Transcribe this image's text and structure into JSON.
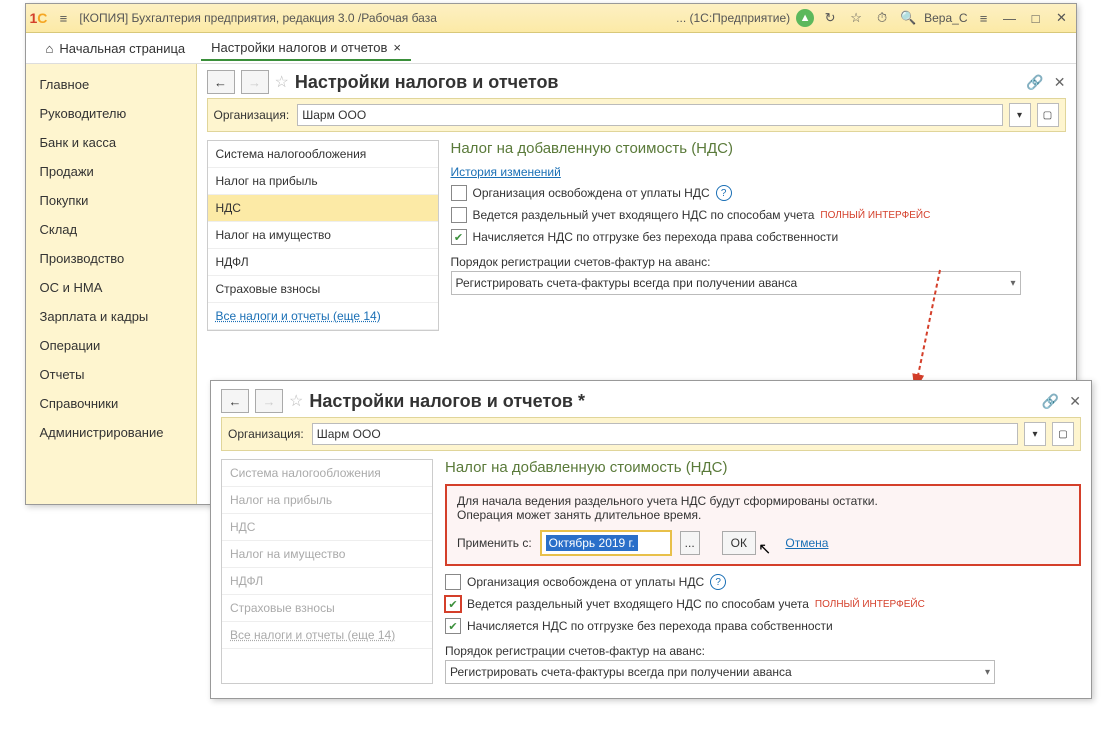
{
  "titlebar": {
    "app_title": "[КОПИЯ] Бухгалтерия предприятия, редакция 3.0 /Рабочая база",
    "suffix": "... (1С:Предприятие)",
    "user": "Вера_С"
  },
  "tabs": {
    "home": "Начальная страница",
    "active": "Настройки налогов и отчетов"
  },
  "sidebar": {
    "items": [
      "Главное",
      "Руководителю",
      "Банк и касса",
      "Продажи",
      "Покупки",
      "Склад",
      "Производство",
      "ОС и НМА",
      "Зарплата и кадры",
      "Операции",
      "Отчеты",
      "Справочники",
      "Администрирование"
    ]
  },
  "page": {
    "title": "Настройки налогов и отчетов",
    "title_modified": "Настройки налогов и отчетов *",
    "org_label": "Организация:",
    "org_value": "Шарм ООО"
  },
  "settings_list": {
    "items": [
      "Система налогообложения",
      "Налог на прибыль",
      "НДС",
      "Налог на имущество",
      "НДФЛ",
      "Страховые взносы"
    ],
    "link": "Все налоги и отчеты (еще 14)"
  },
  "vat": {
    "section_title": "Налог на добавленную стоимость (НДС)",
    "history_link": "История изменений",
    "chk1": "Организация освобождена от уплаты НДС",
    "chk2": "Ведется раздельный учет входящего НДС по способам учета",
    "badge": "ПОЛНЫЙ ИНТЕРФЕЙС",
    "chk3": "Начисляется НДС по отгрузке без перехода права собственности",
    "select_label": "Порядок регистрации счетов-фактур на аванс:",
    "select_value": "Регистрировать счета-фактуры всегда при получении аванса"
  },
  "alert": {
    "line1": "Для начала ведения раздельного учета НДС будут сформированы остатки.",
    "line2": "Операция может занять длительное время.",
    "apply_label": "Применить с:",
    "date": "Октябрь 2019 г.",
    "ok": "ОК",
    "cancel": "Отмена"
  }
}
